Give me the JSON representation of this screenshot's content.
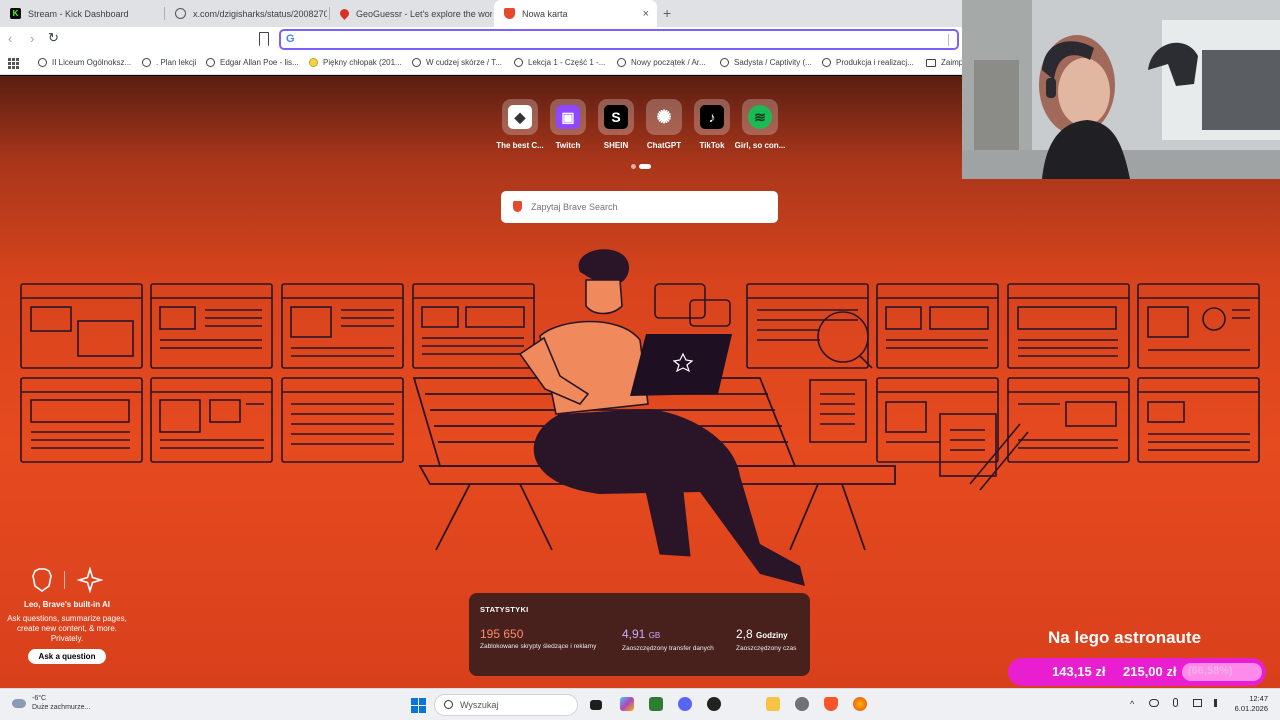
{
  "tabs": [
    {
      "title": "Stream - Kick Dashboard",
      "icon": "kick-icon",
      "color": "#53fc18"
    },
    {
      "title": "x.com/dzigisharks/status/20082707f",
      "icon": "globe-icon",
      "color": "#555555"
    },
    {
      "title": "GeoGuessr - Let's explore the world!",
      "icon": "geoguessr-icon",
      "color": "#d93025"
    },
    {
      "title": "Nowa karta",
      "icon": "brave-icon",
      "color": "#e5482b"
    }
  ],
  "new_tab_symbol": "+",
  "tab_close_symbol": "×",
  "address_bar": {
    "value": "",
    "engine_icon": "G"
  },
  "bookmarks": [
    "II Liceum Ogólnoksz...",
    ". Plan lekcji",
    "Edgar Allan Poe - lis...",
    "Piękny chłopak (201...",
    "W cudzej skórze / T...",
    "Lekcja 1 - Część 1 -...",
    "Nowy początek / Ar...",
    "Sadysta / Captivity (...",
    "Produkcja i realizacj...",
    "Zaimp"
  ],
  "top_sites": [
    {
      "label": "The best C...",
      "icon": "gamepad-icon",
      "bg": "#ffffff",
      "fg": "#333333",
      "glyph": "◆"
    },
    {
      "label": "Twitch",
      "icon": "twitch-icon",
      "bg": "#9146ff",
      "fg": "#ffffff",
      "glyph": "▣"
    },
    {
      "label": "SHEIN",
      "icon": "shein-icon",
      "bg": "#000000",
      "fg": "#ffffff",
      "glyph": "S"
    },
    {
      "label": "ChatGPT",
      "icon": "chatgpt-icon",
      "bg": "transparent",
      "fg": "#ffffff",
      "glyph": "✺"
    },
    {
      "label": "TikTok",
      "icon": "tiktok-icon",
      "bg": "#000000",
      "fg": "#ffffff",
      "glyph": "♪"
    },
    {
      "label": "Girl, so con...",
      "icon": "spotify-icon",
      "bg": "#1db954",
      "fg": "#0b3d1e",
      "glyph": "≋"
    }
  ],
  "search": {
    "placeholder": "Zapytaj Brave Search"
  },
  "leo": {
    "title": "Leo, Brave's built-in AI",
    "description": "Ask questions, summarize pages, create new content, & more. Privately.",
    "button": "Ask a question"
  },
  "stats": {
    "heading": "STATYSTYKI",
    "items": [
      {
        "value": "195 650",
        "unit": "",
        "label": "Zablokowane skrypty śledzące i reklamy",
        "color": "#ff8a6b"
      },
      {
        "value": "4,91",
        "unit": "GB",
        "label": "Zaoszczędzony transfer danych",
        "color": "#c9a8ff"
      },
      {
        "value": "2,8",
        "unit": "Godziny",
        "label": "Zaoszczędzony czas",
        "color": "#ffffff"
      }
    ]
  },
  "stream_goal": {
    "title": "Na lego astronaute",
    "current": "143,15 zł",
    "target": "215,00 zł",
    "percent_text": "(66,58%)",
    "progress": 0.6658
  },
  "taskbar": {
    "weather_temp": "-6°C",
    "weather_desc": "Duże zachmurze...",
    "search_placeholder": "Wyszukaj",
    "time": "12:47",
    "date": "6.01.2026",
    "tray_glyph": "^"
  }
}
